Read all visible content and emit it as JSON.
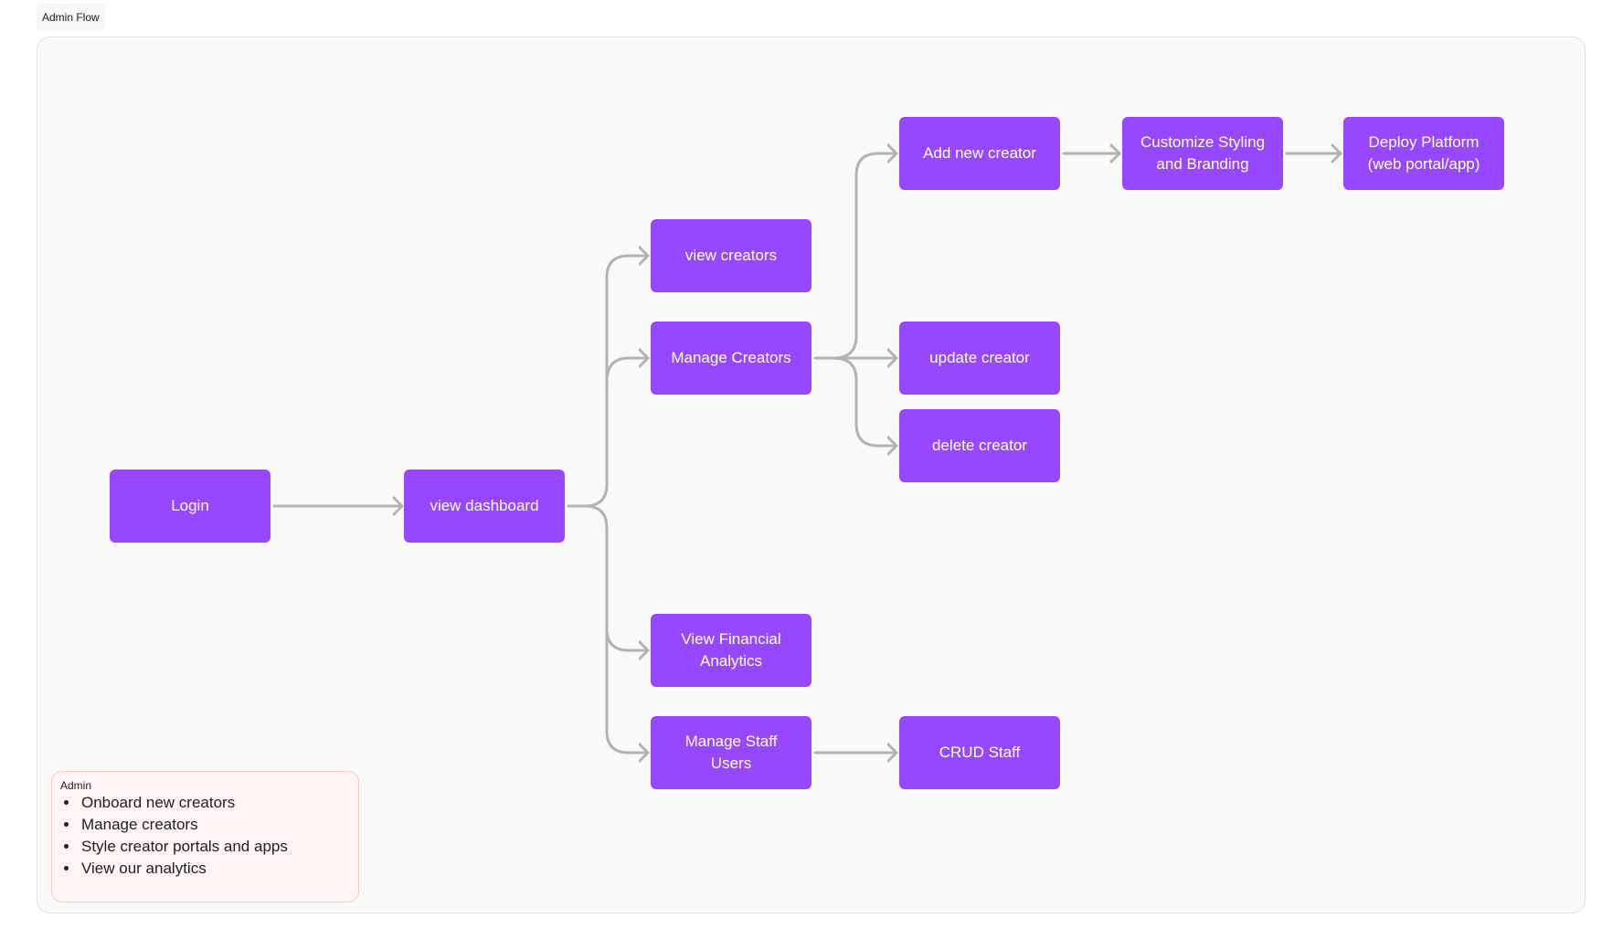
{
  "page": {
    "title": "Admin Flow"
  },
  "colors": {
    "node_fill": "#9747ff",
    "node_text": "#ffffff",
    "connector": "#b3b3b3",
    "frame_bg": "#f9f9f9",
    "note_bg": "#fff5f5",
    "note_border": "#ffc7c2"
  },
  "nodes": {
    "login": "Login",
    "view_dashboard": "view dashboard",
    "view_creators": "view creators",
    "manage_creators": "Manage Creators",
    "add_new_creator": "Add new creator",
    "customize_styling": "Customize Styling and Branding",
    "deploy_platform": "Deploy Platform (web portal/app)",
    "update_creator": "update creator",
    "delete_creator": "delete creator",
    "view_financial_analytics": "View Financial Analytics",
    "manage_staff_users": "Manage Staff Users",
    "crud_staff": "CRUD Staff"
  },
  "edges": [
    {
      "from": "login",
      "to": "view_dashboard"
    },
    {
      "from": "view_dashboard",
      "to": "view_creators"
    },
    {
      "from": "view_dashboard",
      "to": "manage_creators"
    },
    {
      "from": "view_dashboard",
      "to": "view_financial_analytics"
    },
    {
      "from": "view_dashboard",
      "to": "manage_staff_users"
    },
    {
      "from": "manage_creators",
      "to": "add_new_creator"
    },
    {
      "from": "manage_creators",
      "to": "update_creator"
    },
    {
      "from": "manage_creators",
      "to": "delete_creator"
    },
    {
      "from": "add_new_creator",
      "to": "customize_styling"
    },
    {
      "from": "customize_styling",
      "to": "deploy_platform"
    },
    {
      "from": "manage_staff_users",
      "to": "crud_staff"
    }
  ],
  "note": {
    "title": "Admin",
    "items": [
      "Onboard new creators",
      "Manage creators",
      "Style creator portals and apps",
      "View our analytics"
    ]
  }
}
